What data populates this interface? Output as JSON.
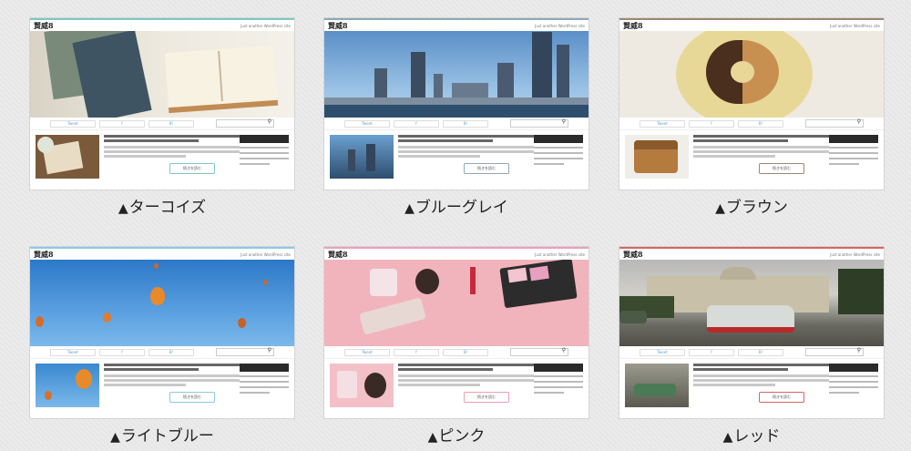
{
  "site": {
    "logo_text": "賢威8",
    "tagline": "Just another WordPress site",
    "nav_labels": [
      "Tweet",
      "f",
      "B!"
    ],
    "search_icon": "🔍",
    "read_more": "続きを読む"
  },
  "themes": [
    {
      "caption": "ターコイズ",
      "accent": "#7ec8c8"
    },
    {
      "caption": "ブルーグレイ",
      "accent": "#8fa8b8"
    },
    {
      "caption": "ブラウン",
      "accent": "#a08870"
    },
    {
      "caption": "ライトブルー",
      "accent": "#8cc8e8"
    },
    {
      "caption": "ピンク",
      "accent": "#eaa0b4"
    },
    {
      "caption": "レッド",
      "accent": "#d86464"
    }
  ],
  "caption_prefix": "▲"
}
